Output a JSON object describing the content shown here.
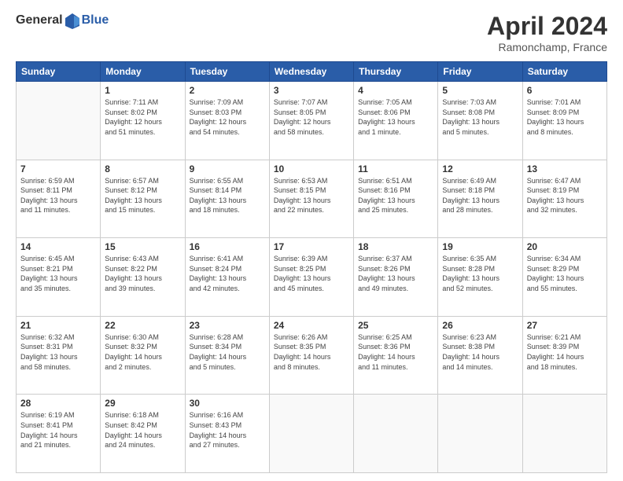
{
  "logo": {
    "general": "General",
    "blue": "Blue"
  },
  "title": {
    "month_year": "April 2024",
    "location": "Ramonchamp, France"
  },
  "days_of_week": [
    "Sunday",
    "Monday",
    "Tuesday",
    "Wednesday",
    "Thursday",
    "Friday",
    "Saturday"
  ],
  "weeks": [
    [
      {
        "day": "",
        "info": ""
      },
      {
        "day": "1",
        "info": "Sunrise: 7:11 AM\nSunset: 8:02 PM\nDaylight: 12 hours\nand 51 minutes."
      },
      {
        "day": "2",
        "info": "Sunrise: 7:09 AM\nSunset: 8:03 PM\nDaylight: 12 hours\nand 54 minutes."
      },
      {
        "day": "3",
        "info": "Sunrise: 7:07 AM\nSunset: 8:05 PM\nDaylight: 12 hours\nand 58 minutes."
      },
      {
        "day": "4",
        "info": "Sunrise: 7:05 AM\nSunset: 8:06 PM\nDaylight: 13 hours\nand 1 minute."
      },
      {
        "day": "5",
        "info": "Sunrise: 7:03 AM\nSunset: 8:08 PM\nDaylight: 13 hours\nand 5 minutes."
      },
      {
        "day": "6",
        "info": "Sunrise: 7:01 AM\nSunset: 8:09 PM\nDaylight: 13 hours\nand 8 minutes."
      }
    ],
    [
      {
        "day": "7",
        "info": "Sunrise: 6:59 AM\nSunset: 8:11 PM\nDaylight: 13 hours\nand 11 minutes."
      },
      {
        "day": "8",
        "info": "Sunrise: 6:57 AM\nSunset: 8:12 PM\nDaylight: 13 hours\nand 15 minutes."
      },
      {
        "day": "9",
        "info": "Sunrise: 6:55 AM\nSunset: 8:14 PM\nDaylight: 13 hours\nand 18 minutes."
      },
      {
        "day": "10",
        "info": "Sunrise: 6:53 AM\nSunset: 8:15 PM\nDaylight: 13 hours\nand 22 minutes."
      },
      {
        "day": "11",
        "info": "Sunrise: 6:51 AM\nSunset: 8:16 PM\nDaylight: 13 hours\nand 25 minutes."
      },
      {
        "day": "12",
        "info": "Sunrise: 6:49 AM\nSunset: 8:18 PM\nDaylight: 13 hours\nand 28 minutes."
      },
      {
        "day": "13",
        "info": "Sunrise: 6:47 AM\nSunset: 8:19 PM\nDaylight: 13 hours\nand 32 minutes."
      }
    ],
    [
      {
        "day": "14",
        "info": "Sunrise: 6:45 AM\nSunset: 8:21 PM\nDaylight: 13 hours\nand 35 minutes."
      },
      {
        "day": "15",
        "info": "Sunrise: 6:43 AM\nSunset: 8:22 PM\nDaylight: 13 hours\nand 39 minutes."
      },
      {
        "day": "16",
        "info": "Sunrise: 6:41 AM\nSunset: 8:24 PM\nDaylight: 13 hours\nand 42 minutes."
      },
      {
        "day": "17",
        "info": "Sunrise: 6:39 AM\nSunset: 8:25 PM\nDaylight: 13 hours\nand 45 minutes."
      },
      {
        "day": "18",
        "info": "Sunrise: 6:37 AM\nSunset: 8:26 PM\nDaylight: 13 hours\nand 49 minutes."
      },
      {
        "day": "19",
        "info": "Sunrise: 6:35 AM\nSunset: 8:28 PM\nDaylight: 13 hours\nand 52 minutes."
      },
      {
        "day": "20",
        "info": "Sunrise: 6:34 AM\nSunset: 8:29 PM\nDaylight: 13 hours\nand 55 minutes."
      }
    ],
    [
      {
        "day": "21",
        "info": "Sunrise: 6:32 AM\nSunset: 8:31 PM\nDaylight: 13 hours\nand 58 minutes."
      },
      {
        "day": "22",
        "info": "Sunrise: 6:30 AM\nSunset: 8:32 PM\nDaylight: 14 hours\nand 2 minutes."
      },
      {
        "day": "23",
        "info": "Sunrise: 6:28 AM\nSunset: 8:34 PM\nDaylight: 14 hours\nand 5 minutes."
      },
      {
        "day": "24",
        "info": "Sunrise: 6:26 AM\nSunset: 8:35 PM\nDaylight: 14 hours\nand 8 minutes."
      },
      {
        "day": "25",
        "info": "Sunrise: 6:25 AM\nSunset: 8:36 PM\nDaylight: 14 hours\nand 11 minutes."
      },
      {
        "day": "26",
        "info": "Sunrise: 6:23 AM\nSunset: 8:38 PM\nDaylight: 14 hours\nand 14 minutes."
      },
      {
        "day": "27",
        "info": "Sunrise: 6:21 AM\nSunset: 8:39 PM\nDaylight: 14 hours\nand 18 minutes."
      }
    ],
    [
      {
        "day": "28",
        "info": "Sunrise: 6:19 AM\nSunset: 8:41 PM\nDaylight: 14 hours\nand 21 minutes."
      },
      {
        "day": "29",
        "info": "Sunrise: 6:18 AM\nSunset: 8:42 PM\nDaylight: 14 hours\nand 24 minutes."
      },
      {
        "day": "30",
        "info": "Sunrise: 6:16 AM\nSunset: 8:43 PM\nDaylight: 14 hours\nand 27 minutes."
      },
      {
        "day": "",
        "info": ""
      },
      {
        "day": "",
        "info": ""
      },
      {
        "day": "",
        "info": ""
      },
      {
        "day": "",
        "info": ""
      }
    ]
  ]
}
